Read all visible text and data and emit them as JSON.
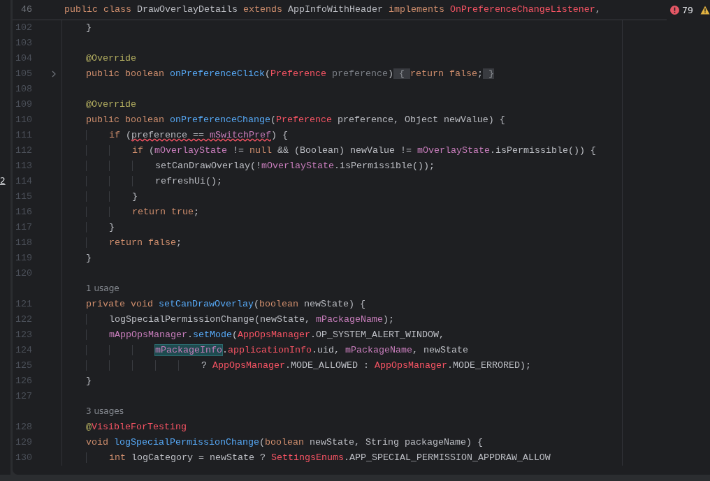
{
  "side_panel": {
    "text": "2"
  },
  "sticky_header": {
    "number": "46",
    "tokens": [
      {
        "text": "public class ",
        "kind": "keyword"
      },
      {
        "text": "DrawOverlayDetails ",
        "kind": "plain"
      },
      {
        "text": "extends ",
        "kind": "keyword"
      },
      {
        "text": "AppInfoWithHeader ",
        "kind": "plain"
      },
      {
        "text": "implements ",
        "kind": "keyword"
      },
      {
        "text": "OnPreferenceChangeListener",
        "kind": "unresolved"
      },
      {
        "text": ",",
        "kind": "plain"
      }
    ]
  },
  "problems": {
    "errors": "79"
  },
  "lines": [
    {
      "number": "102",
      "folded": false,
      "tokens": [
        {
          "text": "    }",
          "kind": "plain"
        }
      ]
    },
    {
      "number": "103",
      "folded": false
    },
    {
      "number": "104",
      "folded": false,
      "tokens": [
        {
          "text": "    @Override",
          "kind": "annotation"
        }
      ]
    },
    {
      "number": "105",
      "folded": true,
      "tokens": [
        {
          "text": "    public boolean ",
          "kind": "keyword"
        },
        {
          "text": "onPreferenceClick",
          "kind": "method"
        },
        {
          "text": "(",
          "kind": "plain"
        },
        {
          "text": "Preference",
          "kind": "unresolved"
        },
        {
          "text": " preference",
          "kind": "unused"
        },
        {
          "text": ")",
          "kind": "plain"
        },
        {
          "text": " { ",
          "kind": "folded"
        },
        {
          "text": "return false",
          "kind": "keyword"
        },
        {
          "text": ";",
          "kind": "plain"
        },
        {
          "text": " }",
          "kind": "folded"
        }
      ]
    },
    {
      "number": "108",
      "folded": false
    },
    {
      "number": "109",
      "folded": false,
      "tokens": [
        {
          "text": "    @Override",
          "kind": "annotation"
        }
      ]
    },
    {
      "number": "110",
      "folded": false,
      "tokens": [
        {
          "text": "    public boolean ",
          "kind": "keyword"
        },
        {
          "text": "onPreferenceChange",
          "kind": "method"
        },
        {
          "text": "(",
          "kind": "plain"
        },
        {
          "text": "Preference",
          "kind": "unresolved"
        },
        {
          "text": " preference, Object newValue) {",
          "kind": "plain"
        }
      ]
    },
    {
      "number": "111",
      "folded": false,
      "tokens": [
        {
          "text": "        if ",
          "kind": "keyword"
        },
        {
          "text": "(",
          "kind": "plain"
        },
        {
          "text": "preference == ",
          "kind": "squiggle"
        },
        {
          "text": "mSwitchPref",
          "kind": "squigglefield"
        },
        {
          "text": ") {",
          "kind": "plain"
        }
      ]
    },
    {
      "number": "112",
      "folded": false,
      "tokens": [
        {
          "text": "            if ",
          "kind": "keyword"
        },
        {
          "text": "(",
          "kind": "plain"
        },
        {
          "text": "mOverlayState",
          "kind": "field"
        },
        {
          "text": " != ",
          "kind": "plain"
        },
        {
          "text": "null",
          "kind": "keyword"
        },
        {
          "text": " && (Boolean) newValue != ",
          "kind": "plain"
        },
        {
          "text": "mOverlayState",
          "kind": "field"
        },
        {
          "text": ".isPermissible()) {",
          "kind": "plain"
        }
      ]
    },
    {
      "number": "113",
      "folded": false,
      "tokens": [
        {
          "text": "                setCanDrawOverlay(!",
          "kind": "plain"
        },
        {
          "text": "mOverlayState",
          "kind": "field"
        },
        {
          "text": ".isPermissible());",
          "kind": "plain"
        }
      ]
    },
    {
      "number": "114",
      "folded": false,
      "tokens": [
        {
          "text": "                refreshUi();",
          "kind": "plain"
        }
      ]
    },
    {
      "number": "115",
      "folded": false,
      "tokens": [
        {
          "text": "            }",
          "kind": "plain"
        }
      ]
    },
    {
      "number": "116",
      "folded": false,
      "tokens": [
        {
          "text": "            return true",
          "kind": "keyword"
        },
        {
          "text": ";",
          "kind": "plain"
        }
      ]
    },
    {
      "number": "117",
      "folded": false,
      "tokens": [
        {
          "text": "        }",
          "kind": "plain"
        }
      ]
    },
    {
      "number": "118",
      "folded": false,
      "tokens": [
        {
          "text": "        return false",
          "kind": "keyword"
        },
        {
          "text": ";",
          "kind": "plain"
        }
      ]
    },
    {
      "number": "119",
      "folded": false,
      "tokens": [
        {
          "text": "    }",
          "kind": "plain"
        }
      ]
    },
    {
      "number": "120",
      "folded": false
    },
    {
      "number": "121",
      "folded": false,
      "hint": "1 usage",
      "tokens": [
        {
          "text": "    private void ",
          "kind": "keyword"
        },
        {
          "text": "setCanDrawOverlay",
          "kind": "method"
        },
        {
          "text": "(",
          "kind": "plain"
        },
        {
          "text": "boolean",
          "kind": "keyword"
        },
        {
          "text": " newState) {",
          "kind": "plain"
        }
      ]
    },
    {
      "number": "122",
      "folded": false,
      "tokens": [
        {
          "text": "        logSpecialPermissionChange(newState, ",
          "kind": "plain"
        },
        {
          "text": "mPackageName",
          "kind": "field"
        },
        {
          "text": ");",
          "kind": "plain"
        }
      ]
    },
    {
      "number": "123",
      "folded": false,
      "tokens": [
        {
          "text": "        mAppOpsManager",
          "kind": "field"
        },
        {
          "text": ".",
          "kind": "plain"
        },
        {
          "text": "setMode",
          "kind": "method"
        },
        {
          "text": "(",
          "kind": "plain"
        },
        {
          "text": "AppOpsManager",
          "kind": "unresolved"
        },
        {
          "text": ".OP_SYSTEM_ALERT_WINDOW,",
          "kind": "plain"
        }
      ]
    },
    {
      "number": "124",
      "folded": false,
      "tokens": [
        {
          "text": "                mPackageInfo",
          "kind": "match"
        },
        {
          "text": ".",
          "kind": "plain"
        },
        {
          "text": "applicationInfo",
          "kind": "unresolved"
        },
        {
          "text": ".uid, ",
          "kind": "plain"
        },
        {
          "text": "mPackageName",
          "kind": "field"
        },
        {
          "text": ", newState",
          "kind": "plain"
        }
      ]
    },
    {
      "number": "125",
      "folded": false,
      "tokens": [
        {
          "text": "                        ? ",
          "kind": "plain"
        },
        {
          "text": "AppOpsManager",
          "kind": "unresolved"
        },
        {
          "text": ".MODE_ALLOWED : ",
          "kind": "plain"
        },
        {
          "text": "AppOpsManager",
          "kind": "unresolved"
        },
        {
          "text": ".MODE_ERRORED);",
          "kind": "plain"
        }
      ]
    },
    {
      "number": "126",
      "folded": false,
      "tokens": [
        {
          "text": "    }",
          "kind": "plain"
        }
      ]
    },
    {
      "number": "127",
      "folded": false
    },
    {
      "number": "128",
      "folded": false,
      "hint": "3 usages",
      "tokens": [
        {
          "text": "    @",
          "kind": "annotation"
        },
        {
          "text": "VisibleForTesting",
          "kind": "unresolved"
        }
      ]
    },
    {
      "number": "129",
      "folded": false,
      "tokens": [
        {
          "text": "    void ",
          "kind": "keyword"
        },
        {
          "text": "logSpecialPermissionChange",
          "kind": "method"
        },
        {
          "text": "(",
          "kind": "plain"
        },
        {
          "text": "boolean",
          "kind": "keyword"
        },
        {
          "text": " newState, String packageName) {",
          "kind": "plain"
        }
      ]
    },
    {
      "number": "130",
      "folded": false,
      "tokens": [
        {
          "text": "        int ",
          "kind": "keyword"
        },
        {
          "text": "logCategory = newState ? ",
          "kind": "plain"
        },
        {
          "text": "SettingsEnums",
          "kind": "unresolved"
        },
        {
          "text": ".APP_SPECIAL_PERMISSION_APPDRAW_ALLOW",
          "kind": "plain"
        }
      ]
    }
  ]
}
